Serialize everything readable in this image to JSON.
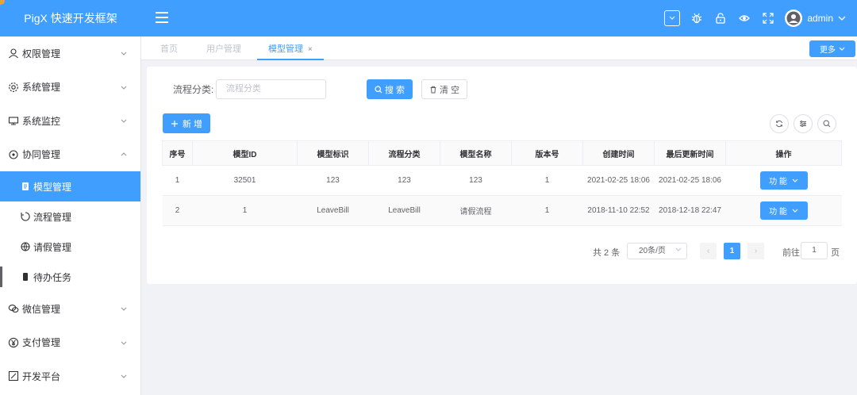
{
  "app": {
    "title": "PigX 快速开发框架",
    "brand_color": "#409eff"
  },
  "header": {
    "username": "admin",
    "icons": [
      "dropdown-box-icon",
      "bug-icon",
      "lock-icon",
      "eye-icon",
      "fullscreen-icon",
      "avatar",
      "chevron-down-icon"
    ]
  },
  "sidebar": {
    "items": [
      {
        "label": "权限管理",
        "icon": "user-icon"
      },
      {
        "label": "系统管理",
        "icon": "gear-icon"
      },
      {
        "label": "系统监控",
        "icon": "monitor-icon"
      },
      {
        "label": "协同管理",
        "icon": "cooperation-icon"
      },
      {
        "label": "微信管理",
        "icon": "wechat-icon"
      },
      {
        "label": "支付管理",
        "icon": "yen-icon"
      },
      {
        "label": "开发平台",
        "icon": "dev-icon"
      }
    ],
    "subitems": [
      {
        "label": "模型管理",
        "icon": "model-icon"
      },
      {
        "label": "流程管理",
        "icon": "process-icon"
      },
      {
        "label": "请假管理",
        "icon": "leave-icon"
      },
      {
        "label": "待办任务",
        "icon": "task-icon"
      }
    ]
  },
  "tabs": [
    {
      "label": "首页"
    },
    {
      "label": "用户管理"
    },
    {
      "label": "模型管理",
      "close": "×"
    }
  ],
  "more_label": "更多",
  "filter": {
    "label": "流程分类:",
    "placeholder": "流程分类",
    "search_label": "搜 索",
    "clear_label": "清 空"
  },
  "toolbar": {
    "add_label": "新 增"
  },
  "table": {
    "columns": [
      "序号",
      "模型ID",
      "模型标识",
      "流程分类",
      "模型名称",
      "版本号",
      "创建时间",
      "最后更新时间",
      "操作"
    ],
    "rows": [
      {
        "index": "1",
        "id": "32501",
        "key": "123",
        "category": "123",
        "name": "123",
        "version": "1",
        "created": "2021-02-25 18:06",
        "updated": "2021-02-25 18:06",
        "action": "功 能"
      },
      {
        "index": "2",
        "id": "1",
        "key": "LeaveBill",
        "category": "LeaveBill",
        "name": "请假流程",
        "version": "1",
        "created": "2018-11-10 22:52",
        "updated": "2018-12-18 22:47",
        "action": "功 能"
      }
    ]
  },
  "pagination": {
    "total_text": "共 2 条",
    "page_size": "20条/页",
    "current_page": "1",
    "goto_label": "前往",
    "goto_value": "1",
    "page_unit": "页",
    "prev": "‹",
    "next": "›"
  }
}
